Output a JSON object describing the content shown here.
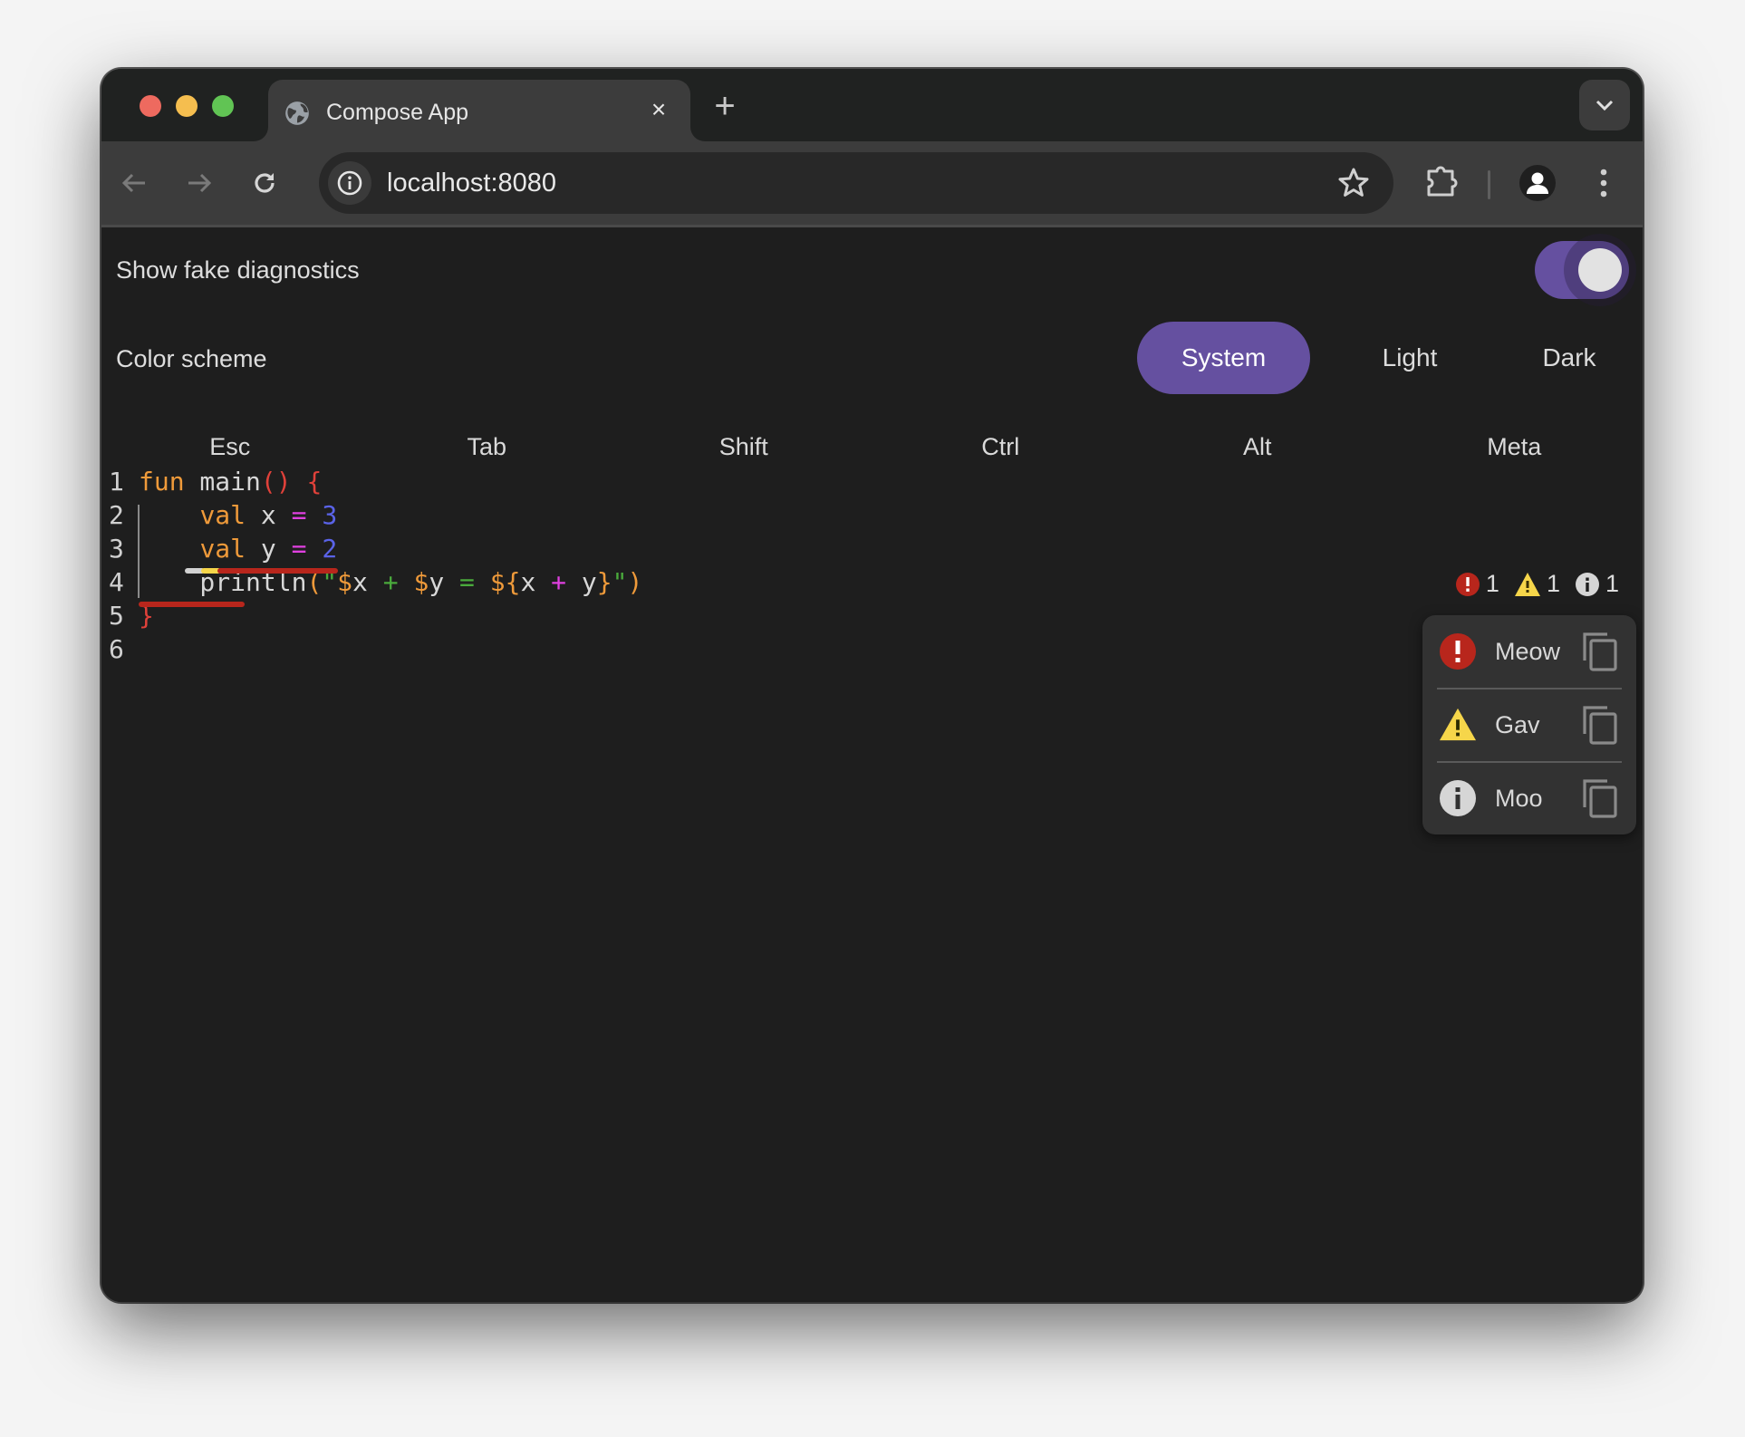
{
  "browser": {
    "tab": {
      "title": "Compose App",
      "favicon": "globe-icon",
      "close_glyph": "×"
    },
    "new_tab_glyph": "+",
    "toolbar": {
      "back_icon": "arrow-left-icon",
      "forward_icon": "arrow-right-icon",
      "reload_icon": "reload-icon",
      "site_info_icon": "info-circle-icon",
      "url": "localhost:8080",
      "bookmark_icon": "star-icon",
      "extensions_icon": "puzzle-icon",
      "profile_icon": "person-icon",
      "menu_icon": "kebab-menu-icon"
    }
  },
  "settings": {
    "fake_diagnostics": {
      "label": "Show fake diagnostics",
      "enabled": true
    },
    "color_scheme": {
      "label": "Color scheme",
      "options": [
        "System",
        "Light",
        "Dark"
      ],
      "selected": "System"
    }
  },
  "keys": [
    "Esc",
    "Tab",
    "Shift",
    "Ctrl",
    "Alt",
    "Meta"
  ],
  "editor": {
    "line_numbers": [
      "1",
      "2",
      "3",
      "4",
      "5",
      "6"
    ],
    "lines": [
      "fun main() {",
      "    val x = 3",
      "    val y = 2",
      "    println(\"$x + $y = ${x + y}\")",
      "}",
      ""
    ],
    "tokens": {
      "l1": [
        "fun",
        " main",
        "()",
        " {"
      ],
      "l2": [
        "    ",
        "val",
        " x ",
        "=",
        " ",
        "3"
      ],
      "l3": [
        "    ",
        "val",
        " y ",
        "=",
        " ",
        "2"
      ],
      "l4": [
        "    println",
        "(",
        "\"",
        "$",
        "x",
        " + ",
        "$",
        "y",
        " = ",
        "${",
        "x",
        " + ",
        "y",
        "}",
        "\"",
        ")"
      ],
      "l5": [
        "}"
      ]
    }
  },
  "diagnostics": {
    "counts": {
      "error": "1",
      "warning": "1",
      "info": "1"
    },
    "items": [
      {
        "severity": "error",
        "message": "Meow",
        "icon": "error-icon",
        "action_icon": "copy-icon"
      },
      {
        "severity": "warning",
        "message": "Gav",
        "icon": "warning-icon",
        "action_icon": "copy-icon"
      },
      {
        "severity": "info",
        "message": "Moo",
        "icon": "info-icon",
        "action_icon": "copy-icon"
      }
    ]
  },
  "colors": {
    "accent": "#6550a0",
    "error": "#b8261c",
    "warning": "#f6d64a",
    "info": "#d6d6d6",
    "keyword": "#ef9a3a",
    "bracket": "#e0413a",
    "operator": "#e040e0",
    "number": "#5a63e8",
    "string": "#4aaa3c"
  }
}
